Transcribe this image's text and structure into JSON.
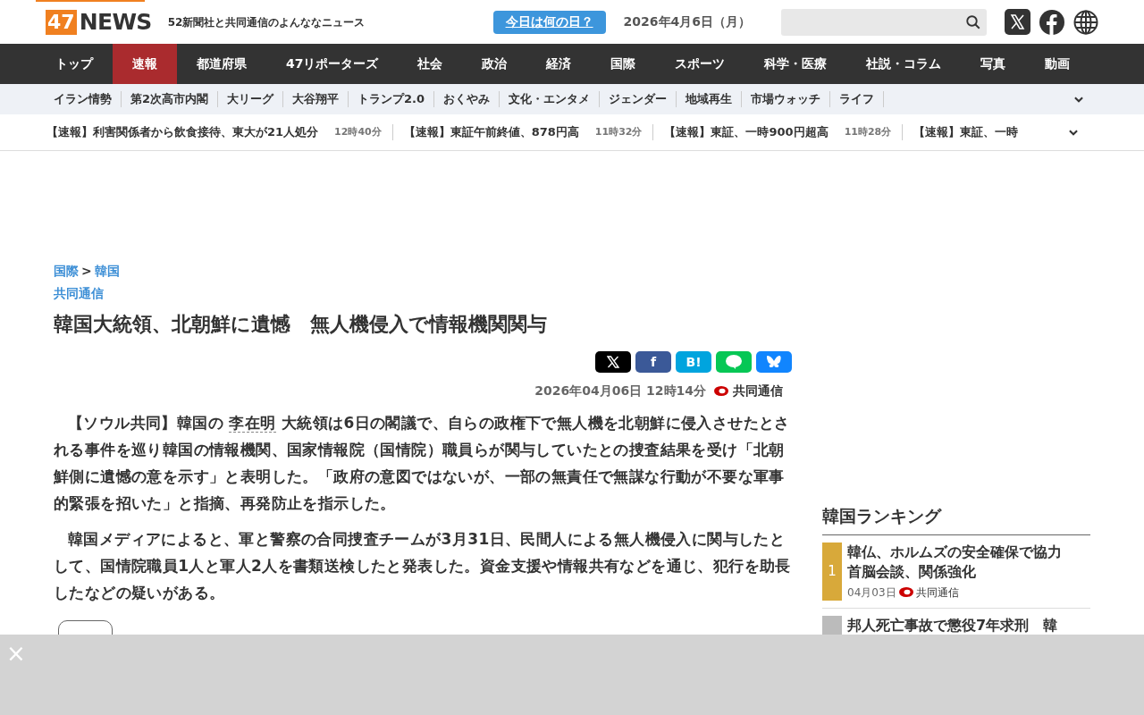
{
  "header": {
    "logo_number": "47",
    "logo_word": "NEWS",
    "tagline": "52新聞社と共同通信のよんななニュース",
    "today_button": "今日は何の日？",
    "date": "2026年4月6日（月）"
  },
  "nav": [
    {
      "label": "トップ",
      "selected": false
    },
    {
      "label": "速報",
      "selected": true
    },
    {
      "label": "都道府県",
      "selected": false
    },
    {
      "label": "47リポーターズ",
      "selected": false
    },
    {
      "label": "社会",
      "selected": false
    },
    {
      "label": "政治",
      "selected": false
    },
    {
      "label": "経済",
      "selected": false
    },
    {
      "label": "国際",
      "selected": false
    },
    {
      "label": "スポーツ",
      "selected": false
    },
    {
      "label": "科学・医療",
      "selected": false
    },
    {
      "label": "社説・コラム",
      "selected": false
    },
    {
      "label": "写真",
      "selected": false
    },
    {
      "label": "動画",
      "selected": false
    }
  ],
  "subnav": [
    "イラン情勢",
    "第2次高市内閣",
    "大リーグ",
    "大谷翔平",
    "トランプ2.0",
    "おくやみ",
    "文化・エンタメ",
    "ジェンダー",
    "地域再生",
    "市場ウォッチ",
    "ライフ"
  ],
  "ticker": [
    {
      "headline": "【速報】利害関係者から飲食接待、東大が21人処分",
      "time": "12時40分"
    },
    {
      "headline": "【速報】東証午前終値、878円高",
      "time": "11時32分"
    },
    {
      "headline": "【速報】東証、一時900円超高",
      "time": "11時28分"
    },
    {
      "headline": "【速報】東証、一時"
    }
  ],
  "article": {
    "breadcrumb": [
      "国際",
      "韓国"
    ],
    "breadcrumb_separator": ">",
    "source_link": "共同通信",
    "title": "韓国大統領、北朝鮮に遺憾　無人機侵入で情報機関関与",
    "datetime": "2026年04月06日 12時14分",
    "source": "共同通信",
    "paragraphs": [
      {
        "before": "【ソウル共同】韓国の",
        "link": "李在明",
        "after": "大統領は6日の閣議で、自らの政権下で無人機を北朝鮮に侵入させたとされる事件を巡り韓国の情報機関、国家情報院（国情院）職員らが関与していたとの捜査結果を受け「北朝鮮側に遺憾の意を示す」と表明した。「政府の意図ではないが、一部の無責任で無謀な行動が不要な軍事的緊張を招いた」と指摘、再発防止を指示した。"
      },
      {
        "before": "韓国メディアによると、軍と警察の合同捜査チームが3月31日、民間人による無人機侵入に関与したとして、国情院職員1人と軍人2人を書類送検したと発表した。資金支援や情報共有などを通じ、犯行を助長したなどの疑いがある。"
      }
    ],
    "share": [
      {
        "kind": "x"
      },
      {
        "kind": "text",
        "label": "f"
      },
      {
        "kind": "text",
        "label": "B!"
      },
      {
        "kind": "line"
      },
      {
        "kind": "butterfly"
      }
    ],
    "tags": [
      {
        "kind": "chip"
      }
    ]
  },
  "ranking": {
    "title": "韓国ランキング",
    "items": [
      {
        "rank": "1",
        "title_lines": [
          "韓仏、ホルムズの安全確保で協力",
          "首脳会談、関係強化"
        ],
        "date": "04月03日",
        "source": "共同通信"
      },
      {
        "title_lines": [
          "邦人死亡事故で懲役7年求刑　韓"
        ]
      }
    ]
  },
  "overlay": {
    "close": "×"
  }
}
